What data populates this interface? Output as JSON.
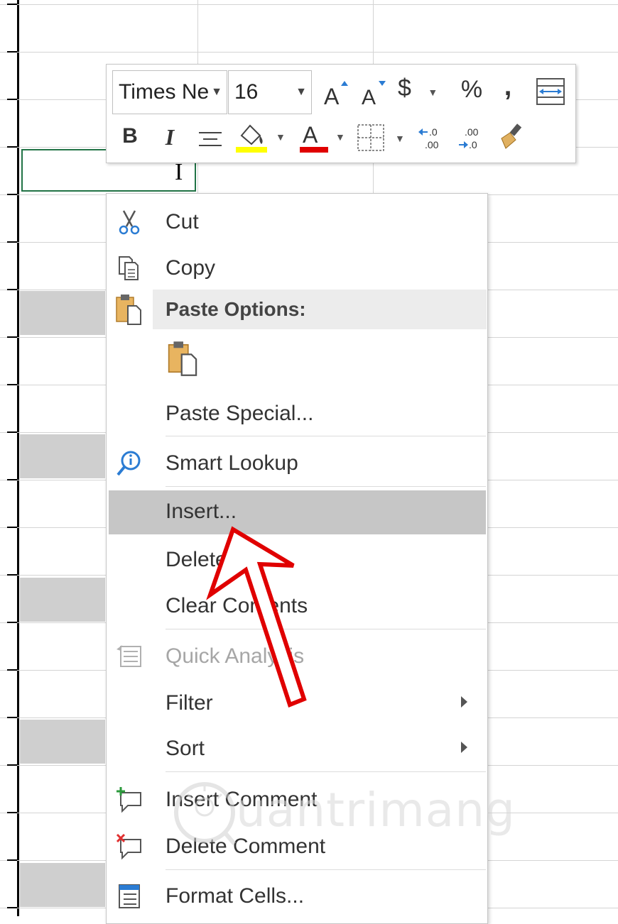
{
  "mini_toolbar": {
    "font_name": "Times Ne",
    "font_size": "16",
    "grow_font": "A",
    "shrink_font": "A",
    "currency": "$",
    "percent": "%",
    "comma": ",",
    "bold": "B",
    "italic": "I",
    "font_color_letter": "A",
    "increase_decimal": ".0\n.00",
    "decrease_decimal": ".00\n.0",
    "fill_color": "#ffff00",
    "font_color": "#e00000"
  },
  "context_menu": {
    "cut": "Cut",
    "copy": "Copy",
    "paste_options_header": "Paste Options:",
    "paste_special": "Paste Special...",
    "smart_lookup": "Smart Lookup",
    "insert": "Insert...",
    "delete": "Delete...",
    "clear_contents": "Clear Contents",
    "quick_analysis": "Quick Analysis",
    "filter": "Filter",
    "sort": "Sort",
    "insert_comment": "Insert Comment",
    "delete_comment": "Delete Comment",
    "format_cells": "Format Cells..."
  },
  "watermark": {
    "text": "uantrimang"
  },
  "colors": {
    "highlight": "#c6c6c6",
    "accent_green": "#217346",
    "annotation_red": "#e00000"
  }
}
